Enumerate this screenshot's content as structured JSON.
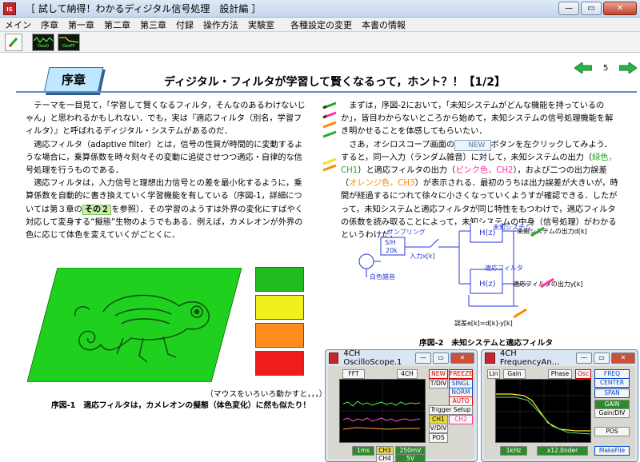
{
  "window": {
    "app_icon": "IS",
    "title": "［ 試して納得！わかるディジタル信号処理　設計編 ］"
  },
  "menu": [
    "メイン",
    "序章",
    "第一章",
    "第二章",
    "第三章",
    "付録",
    "操作方法",
    "実験室",
    "各種設定の変更",
    "本書の情報"
  ],
  "toolbar": {
    "scope_label_1": "OooO",
    "scope_label_2": "OooFF"
  },
  "page": {
    "chapter": "序章",
    "title": "ディジタル・フィルタが学習して賢くなるって，ホント？！【1/2】",
    "page_number": "5"
  },
  "left_col": {
    "p1": "テーマを一目見て，「学習して賢くなるフィルタ，そんなのあるわけないじゃん」と思われるかもしれない．でも，実は『適応フィルタ（別名，学習フィルタ）』と呼ばれるディジタル・システムがあるのだ．",
    "p2": "適応フィルタ（adaptive filter）とは，信号の性質が時間的に変動するような場合に，乗算係数を時々刻々その変動に追従させつつ適応・自律的な信号処理を行うものである．",
    "p3a": "適応フィルタは，入力信号と理想出力信号との差を最小化するように，乗算係数を自動的に書き換えていく学習機能を有している（序図-1，詳細については第３章の",
    "p3_link": "その２",
    "p3b": "を参照）．その学習のようすは外界の変化にすばやく対応して変身する“擬態”生物のようでもある．例えば，カメレオンが外界の色に応じて体色を変えていくがごとくに．"
  },
  "right_col": {
    "p1": "まずは，序図-2において，「未知システムがどんな機能を持っているのか」，皆目わからないところから始めて，未知システムの信号処理機能を解き明かせることを体感してもらいたい．",
    "p2a": "さあ，オシロスコープ画面の",
    "new_btn": "NEW",
    "p2b": "ボタンを左クリックしてみよう．すると，同一入力（ランダム雑音）に対して，未知システムの出力（",
    "green_label": "緑色，CH1",
    "p2c": "）と適応フィルタの出力（",
    "pink_label": "ピンク色，CH2",
    "p2d": "），および二つの出力誤差（",
    "orange_label": "オレンジ色，CH3",
    "p2e": "）が表示される．最初のうちは出力誤差が大きいが，時間が経過するにつれて徐々に小さくなっていくようすが確認できる．したがって，未知システムと適応フィルタが同じ特性をもつわけで，適応フィルタの係数を読み取ることによって，未知システムの中身（信号処理）がわかるというわけだ．"
  },
  "diagram": {
    "sampler": "サンプリング",
    "sh": "S/H",
    "fs": "20k",
    "noise": "白色雑音",
    "input": "入力x[k]",
    "unknown": "未知システム",
    "hz": "H(z)",
    "unknown_out": "未知システムの出力d[k]",
    "adaptive": "適応フィルタ",
    "adaptive_out": "適応フィルタの出力y[k]",
    "error": "誤差e[k]=d[k]-y[k]"
  },
  "captions": {
    "fig1": "序図-1　適応フィルタは，カメレオンの擬態（体色変化）に然も似たり！",
    "mouse": "（マウスをいろいろ動かすと，，，）",
    "fig2": "序図-2　未知システムと適応フィルタ"
  },
  "swatches": [
    "#22bb22",
    "#f2ef1c",
    "#ff8c1a",
    "#ee1c1c"
  ],
  "osc": {
    "title": "4CH OscilloScope.1",
    "fft": "FFT",
    "ch": "4CH",
    "new": "NEW",
    "freeze": "FREEZE",
    "tdiv": "T/DIV",
    "singl": "SINGL",
    "norm": "NORM",
    "auto": "AUTO",
    "trig": "Trigger Setup",
    "ch1": "CH1",
    "ch2": "CH2",
    "vdiv": "V/DIV",
    "pos": "POS",
    "ms": "1ms",
    "ch3": "CH3",
    "ch4": "CH4",
    "mv": "250mV",
    "v": "5V"
  },
  "fa": {
    "title": "4CH FrequencyAn...",
    "lin": "Lin",
    "gain": "Gain",
    "phase": "Phase",
    "osc": "Osc",
    "freq": "FREQ",
    "center": "CENTER",
    "span": "SPAN",
    "gain2": "GAIN",
    "gaindiv": "Gain/DIV",
    "pos": "POS",
    "hz": "1kHz",
    "order": "x12.0nder",
    "make": "MakeFile"
  }
}
